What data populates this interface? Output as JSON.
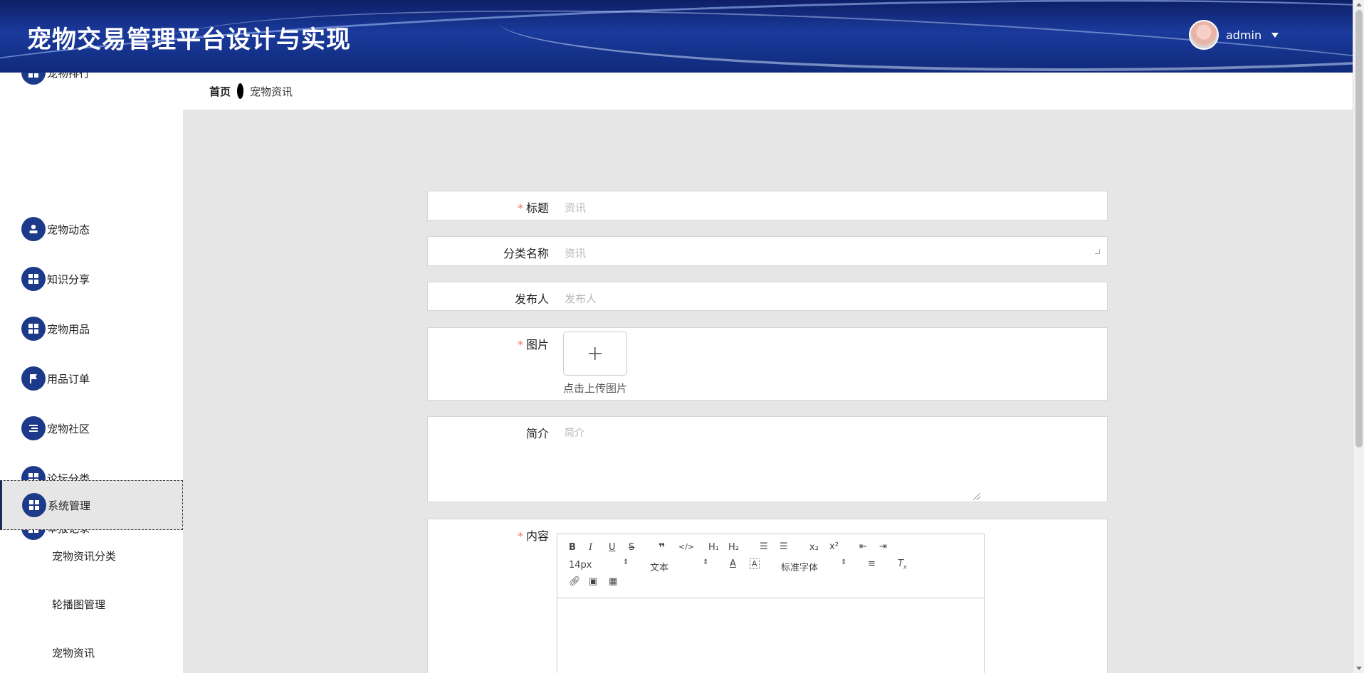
{
  "header": {
    "title": "宠物交易管理平台设计与实现",
    "username": "admin"
  },
  "sidebar": {
    "partial_item": "宠物排行",
    "items": [
      "宠物动态",
      "知识分享",
      "宠物用品",
      "用品订单",
      "宠物社区",
      "论坛分类",
      "举报记录",
      "系统管理"
    ],
    "sub_items": [
      "宠物资讯分类",
      "轮播图管理",
      "宠物资讯"
    ]
  },
  "breadcrumb": {
    "home": "首页",
    "current": "宠物资讯"
  },
  "form": {
    "title": {
      "label": "标题",
      "placeholder": "资讯"
    },
    "category": {
      "label": "分类名称",
      "placeholder": "资讯"
    },
    "publisher": {
      "label": "发布人",
      "placeholder": "发布人"
    },
    "image": {
      "label": "图片",
      "tip": "点击上传图片"
    },
    "summary": {
      "label": "简介",
      "placeholder": "简介"
    },
    "content": {
      "label": "内容"
    }
  },
  "editor": {
    "font_size": "14px",
    "block_type": "文本",
    "font_family": "标准字体"
  },
  "colors": {
    "header": "#1a3a9c",
    "icon_bg": "#1d3a8a",
    "required": "#f56c6c"
  }
}
